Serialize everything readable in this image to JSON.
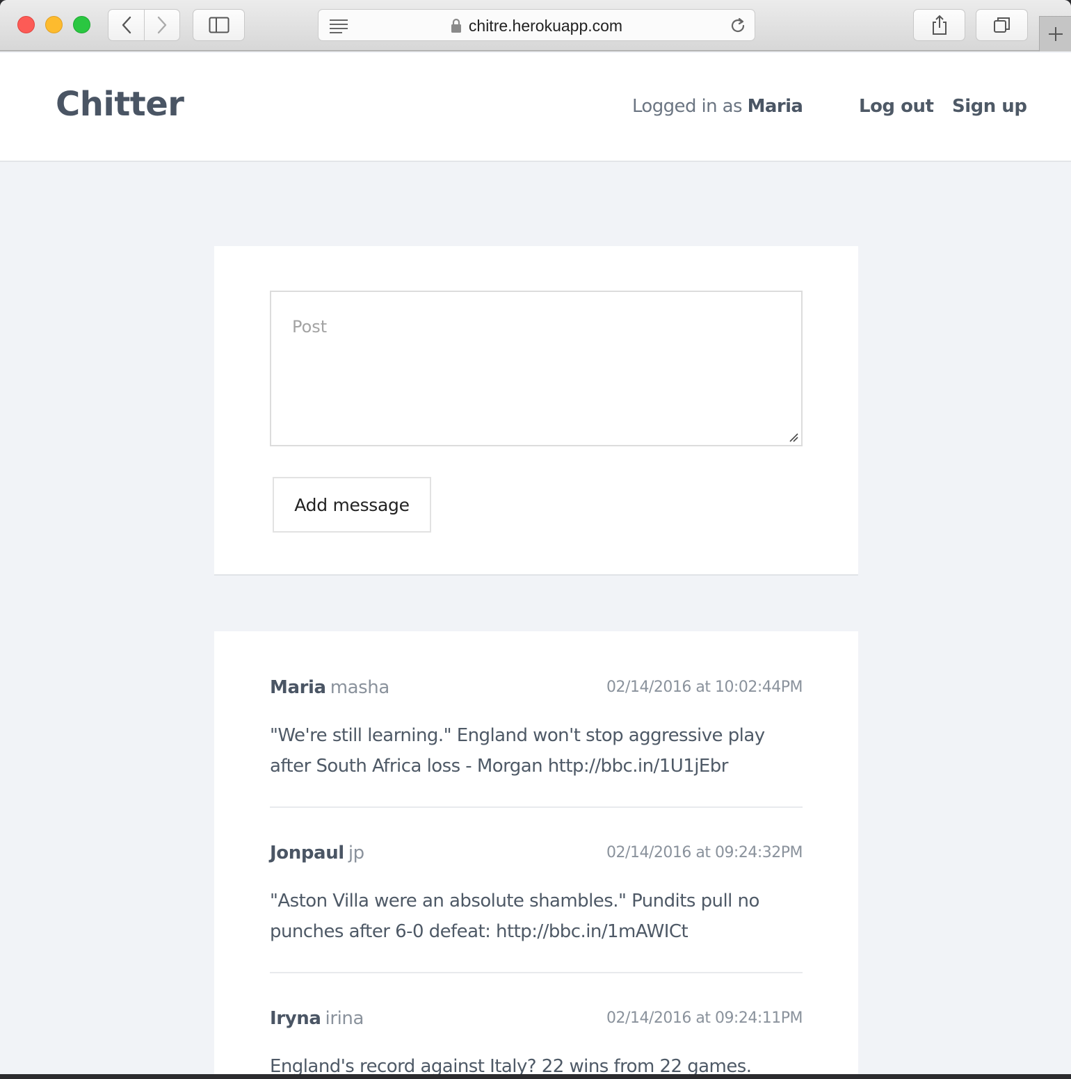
{
  "browser": {
    "url": "chitre.herokuapp.com"
  },
  "header": {
    "brand": "Chitter",
    "logged_in_prefix": "Logged in as",
    "logged_in_user": "Maria",
    "nav": {
      "logout": "Log out",
      "signup": "Sign up"
    }
  },
  "composer": {
    "placeholder": "Post",
    "submit_label": "Add message"
  },
  "feed": [
    {
      "name": "Maria",
      "handle": "masha",
      "timestamp": "02/14/2016 at 10:02:44PM",
      "text": "\"We're still learning.\" England won't stop aggressive play after South Africa loss - Morgan http://bbc.in/1U1jEbr"
    },
    {
      "name": "Jonpaul",
      "handle": "jp",
      "timestamp": "02/14/2016 at 09:24:32PM",
      "text": "\"Aston Villa were an absolute shambles.\" Pundits pull no punches after 6-0 defeat: http://bbc.in/1mAWICt"
    },
    {
      "name": "Iryna",
      "handle": "irina",
      "timestamp": "02/14/2016 at 09:24:11PM",
      "text": "England's record against Italy? 22 wins from 22 games."
    }
  ],
  "icons": {
    "back": "chevron-left-icon",
    "forward": "chevron-right-icon",
    "sidebar": "sidebar-icon",
    "reader": "reader-icon",
    "lock": "lock-icon",
    "reload": "reload-icon",
    "share": "share-icon",
    "tabs": "tabs-icon",
    "new_tab": "plus-icon"
  },
  "colors": {
    "page_bg": "#f1f3f7",
    "brand_text": "#4a5564",
    "muted_text": "#8a929c"
  }
}
